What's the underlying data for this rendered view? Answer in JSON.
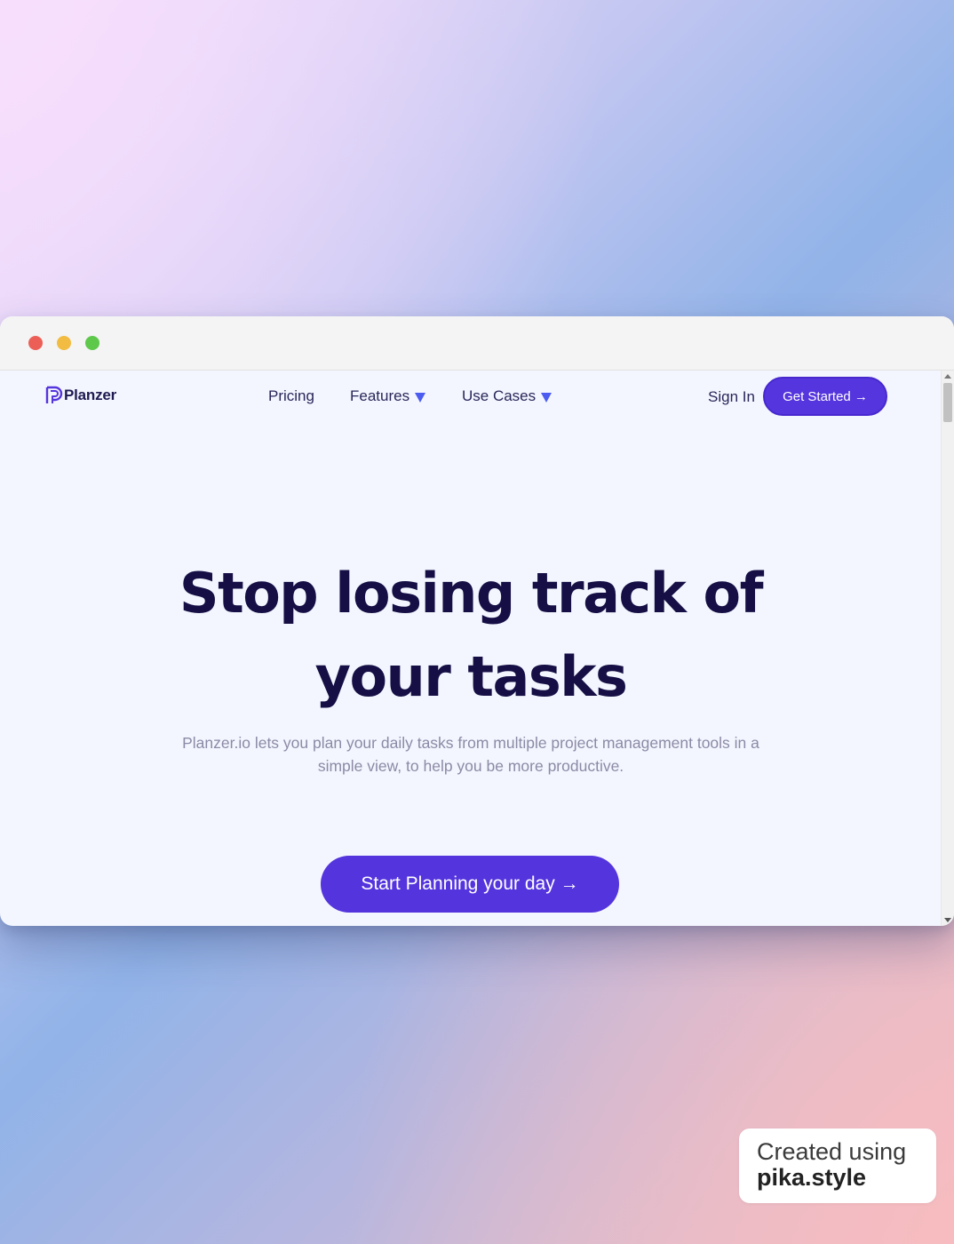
{
  "window": {
    "controls": [
      "close",
      "minimize",
      "maximize"
    ]
  },
  "nav": {
    "logo_text": "Planzer",
    "links": [
      {
        "label": "Pricing",
        "has_dropdown": false
      },
      {
        "label": "Features",
        "has_dropdown": true
      },
      {
        "label": "Use Cases",
        "has_dropdown": true
      }
    ],
    "sign_in": "Sign In",
    "get_started": "Get Started →"
  },
  "hero": {
    "title_line1": "Stop losing track of",
    "title_line2": "your tasks",
    "subtitle": "Planzer.io lets you plan your daily tasks from multiple project management tools in a simple view, to help you be more productive.",
    "cta": "Start Planning your day →"
  },
  "badge": {
    "line1": "Created using",
    "line2": "pika.style"
  },
  "colors": {
    "brand": "#5535dd",
    "heading": "#150f45",
    "caret": "#4c5cf0",
    "page_bg": "#f3f6fe"
  },
  "icons": [
    "logo-mark-icon",
    "caret-down-icon",
    "arrow-right-icon"
  ]
}
